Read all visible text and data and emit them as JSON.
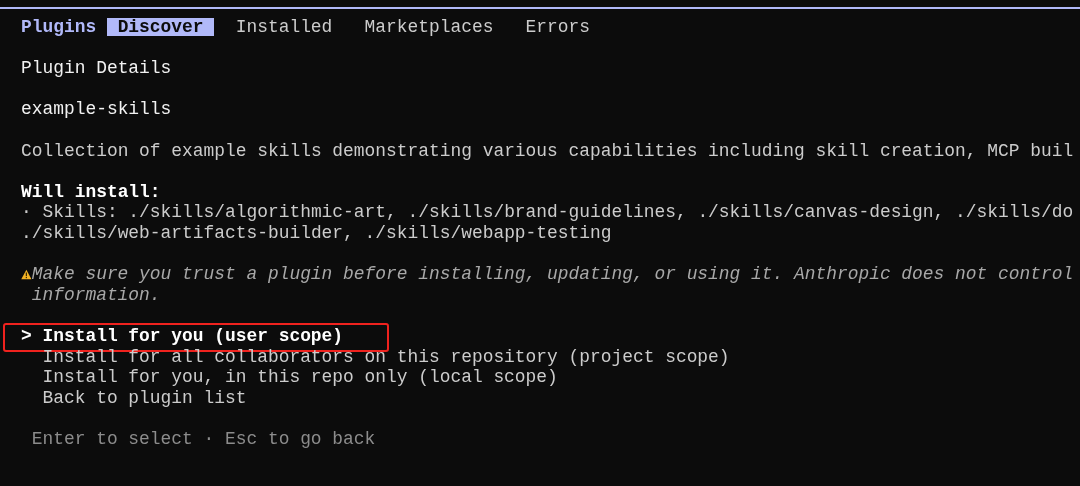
{
  "header": {
    "title": "Plugins"
  },
  "tabs": [
    {
      "label": "Discover",
      "selected": true
    },
    {
      "label": "Installed",
      "selected": false
    },
    {
      "label": "Marketplaces",
      "selected": false
    },
    {
      "label": "Errors",
      "selected": false
    }
  ],
  "section_title": "Plugin Details",
  "plugin": {
    "name": "example-skills",
    "description": "Collection of example skills demonstrating various capabilities including skill creation, MCP buil"
  },
  "install": {
    "heading": "Will install:",
    "lines": [
      "· Skills: ./skills/algorithmic-art, ./skills/brand-guidelines, ./skills/canvas-design, ./skills/do",
      "./skills/web-artifacts-builder, ./skills/webapp-testing"
    ]
  },
  "warning": {
    "lines": [
      "Make sure you trust a plugin before installing, updating, or using it. Anthropic does not control",
      "information."
    ]
  },
  "menu": {
    "pointer": ">",
    "options": [
      {
        "label": "Install for you (user scope)",
        "selected": true
      },
      {
        "label": "Install for all collaborators on this repository (project scope)",
        "selected": false
      },
      {
        "label": "Install for you, in this repo only (local scope)",
        "selected": false
      },
      {
        "label": "Back to plugin list",
        "selected": false
      }
    ]
  },
  "footer": "Enter to select · Esc to go back"
}
